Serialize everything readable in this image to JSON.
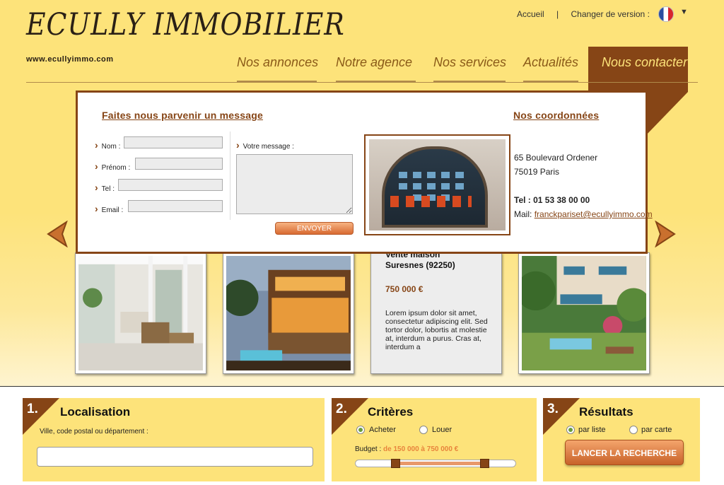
{
  "brand": {
    "logo": "ECULLY IMMOBILIER",
    "url": "www.ecullyimmo.com"
  },
  "toplinks": {
    "home": "Accueil",
    "separator": "|",
    "version": "Changer de version :"
  },
  "nav": [
    "Nos annonces",
    "Notre agence",
    "Nos services",
    "Actualités",
    "Nous contacter"
  ],
  "contact": {
    "form_title": "Faites nous parvenir un message",
    "labels": {
      "nom": "Nom :",
      "prenom": "Prénom :",
      "tel": "Tel :",
      "email": "Email :",
      "message": "Votre message :"
    },
    "send": "ENVOYER",
    "coords_title": "Nos coordonnées",
    "address1": "65 Boulevard Ordener",
    "address2": "75019 Paris",
    "phone": "Tel : 01 53 38 00 00",
    "mail_label": "Mail:",
    "mail": "franckpariset@ecullyimmo.com"
  },
  "listing": {
    "partial_title": "Vente maison",
    "location": "Suresnes (92250)",
    "price": "750 000 €",
    "desc": "Lorem ipsum dolor sit amet, consectetur adipiscing elit. Sed tortor dolor, lobortis at molestie at, interdum a purus. Cras at, interdum a"
  },
  "search": {
    "step1": {
      "num": "1.",
      "title": "Localisation",
      "label": "Ville, code postal ou département :",
      "value": ""
    },
    "step2": {
      "num": "2.",
      "title": "Critères",
      "buy": "Acheter",
      "rent": "Louer",
      "budget_label": "Budget :",
      "budget_value": "de 150 000 à 750 000 €"
    },
    "step3": {
      "num": "3.",
      "title": "Résultats",
      "list": "par liste",
      "map": "par carte",
      "button": "LANCER LA RECHERCHE"
    }
  },
  "icons": {
    "flag": "france-flag-icon",
    "dropdown": "chevron-down-icon",
    "prev": "arrow-left-icon",
    "next": "arrow-right-icon"
  },
  "colors": {
    "accent": "#864516",
    "background": "#fde37a",
    "nav_text": "#8a5a18"
  }
}
